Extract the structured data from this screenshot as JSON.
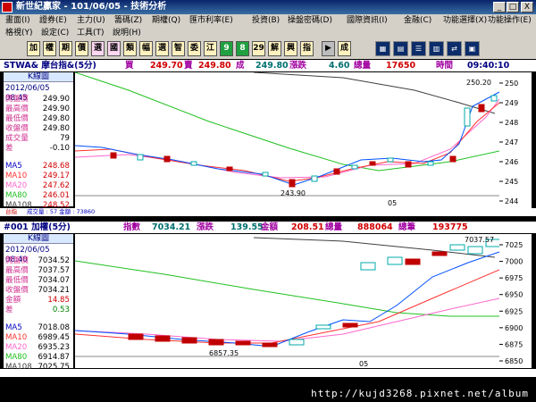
{
  "window": {
    "title": "新世紀贏家 - 101/06/05 - 技術分析",
    "buttons": [
      "_",
      "□",
      "X"
    ]
  },
  "menu": {
    "row1": [
      "畫面(I)",
      "證券(E)",
      "主力(U)",
      "籌碼(Z)",
      "期權(Q)",
      "匯市利率(E)",
      "投資(B)",
      "操盤密碼(D)",
      "國際資訊(I)",
      "金融(C)",
      "功能選擇(X)",
      "功能操作(E)"
    ],
    "row2": [
      "格視(Y)",
      "設定(C)",
      "工具(T)",
      "說明(H)"
    ]
  },
  "toolbar": {
    "buttons": [
      "加",
      "權",
      "期",
      "價",
      "選",
      "國",
      "類",
      "幅",
      "選",
      "智",
      "委",
      "江",
      "9",
      "8",
      "29",
      "解",
      "興",
      "指",
      "▶",
      "成",
      "",
      "",
      "",
      "",
      "",
      ""
    ]
  },
  "panel1": {
    "header": {
      "symbol": "STWA& 摩台指&(5分)",
      "buy_label": "買",
      "buy": "249.70",
      "sell_label": "賣",
      "sell": "249.80",
      "deal_label": "成",
      "deal": "249.80",
      "change_label": "漲跌",
      "change": "4.60",
      "volume_label": "總量",
      "volume": "17650",
      "time_label": "時間",
      "time": "09:40:10"
    },
    "info": {
      "title": "K線圖",
      "date": "2012/06/05 08:45",
      "rows": [
        {
          "k": "開盤價",
          "v": "249.90"
        },
        {
          "k": "最高價",
          "v": "249.90"
        },
        {
          "k": "最低價",
          "v": "249.80"
        },
        {
          "k": "收盤價",
          "v": "249.80"
        },
        {
          "k": "成交量",
          "v": "79"
        },
        {
          "k": "差",
          "v": "-0.10"
        }
      ],
      "ma": [
        {
          "k": "MA5",
          "v": "248.68"
        },
        {
          "k": "MA10",
          "v": "249.17"
        },
        {
          "k": "MA20",
          "v": "247.62"
        },
        {
          "k": "MA80",
          "v": "246.01"
        },
        {
          "k": "MA108",
          "v": "248.52"
        }
      ]
    },
    "yaxis": [
      "250",
      "249",
      "248",
      "247",
      "246",
      "245",
      "244"
    ],
    "xlabel": "05",
    "peak_label": "250.20",
    "low_label": "243.90",
    "status": [
      "台指",
      "成交量 : 57 金額 : 73860"
    ]
  },
  "panel2": {
    "header": {
      "symbol": "#001 加權(5分)",
      "index_label": "指數",
      "index": "7034.21",
      "change_label": "漲跌",
      "change": "139.55",
      "amount_label": "金額",
      "amount": "208.51",
      "volume_label": "總量",
      "volume": "888064",
      "count_label": "總筆",
      "count": "193775"
    },
    "info": {
      "title": "K線圖",
      "date": "2012/06/05 08:40",
      "rows": [
        {
          "k": "開盤價",
          "v": "7034.52"
        },
        {
          "k": "最高價",
          "v": "7037.57"
        },
        {
          "k": "最低價",
          "v": "7034.07"
        },
        {
          "k": "收盤價",
          "v": "7034.21"
        },
        {
          "k": "金額",
          "v": "14.85"
        },
        {
          "k": "差",
          "v": "0.53"
        }
      ],
      "ma": [
        {
          "k": "MA5",
          "v": "7018.08"
        },
        {
          "k": "MA10",
          "v": "6989.45"
        },
        {
          "k": "MA20",
          "v": "6935.23"
        },
        {
          "k": "MA80",
          "v": "6914.87"
        },
        {
          "k": "MA108",
          "v": "7025.75"
        }
      ]
    },
    "yaxis": [
      "7025",
      "7000",
      "6975",
      "6950",
      "6925",
      "6900",
      "6875",
      "6850"
    ],
    "xlabel": "05",
    "peak_label": "7037.57",
    "low_label": "6857.35"
  },
  "watermark": "http://kujd3268.pixnet.net/album",
  "colors": {
    "ma5": "#0050ff",
    "ma10": "#ff3030",
    "ma20": "#ff66cc",
    "ma80": "#20c020",
    "ma108": "#404040"
  }
}
